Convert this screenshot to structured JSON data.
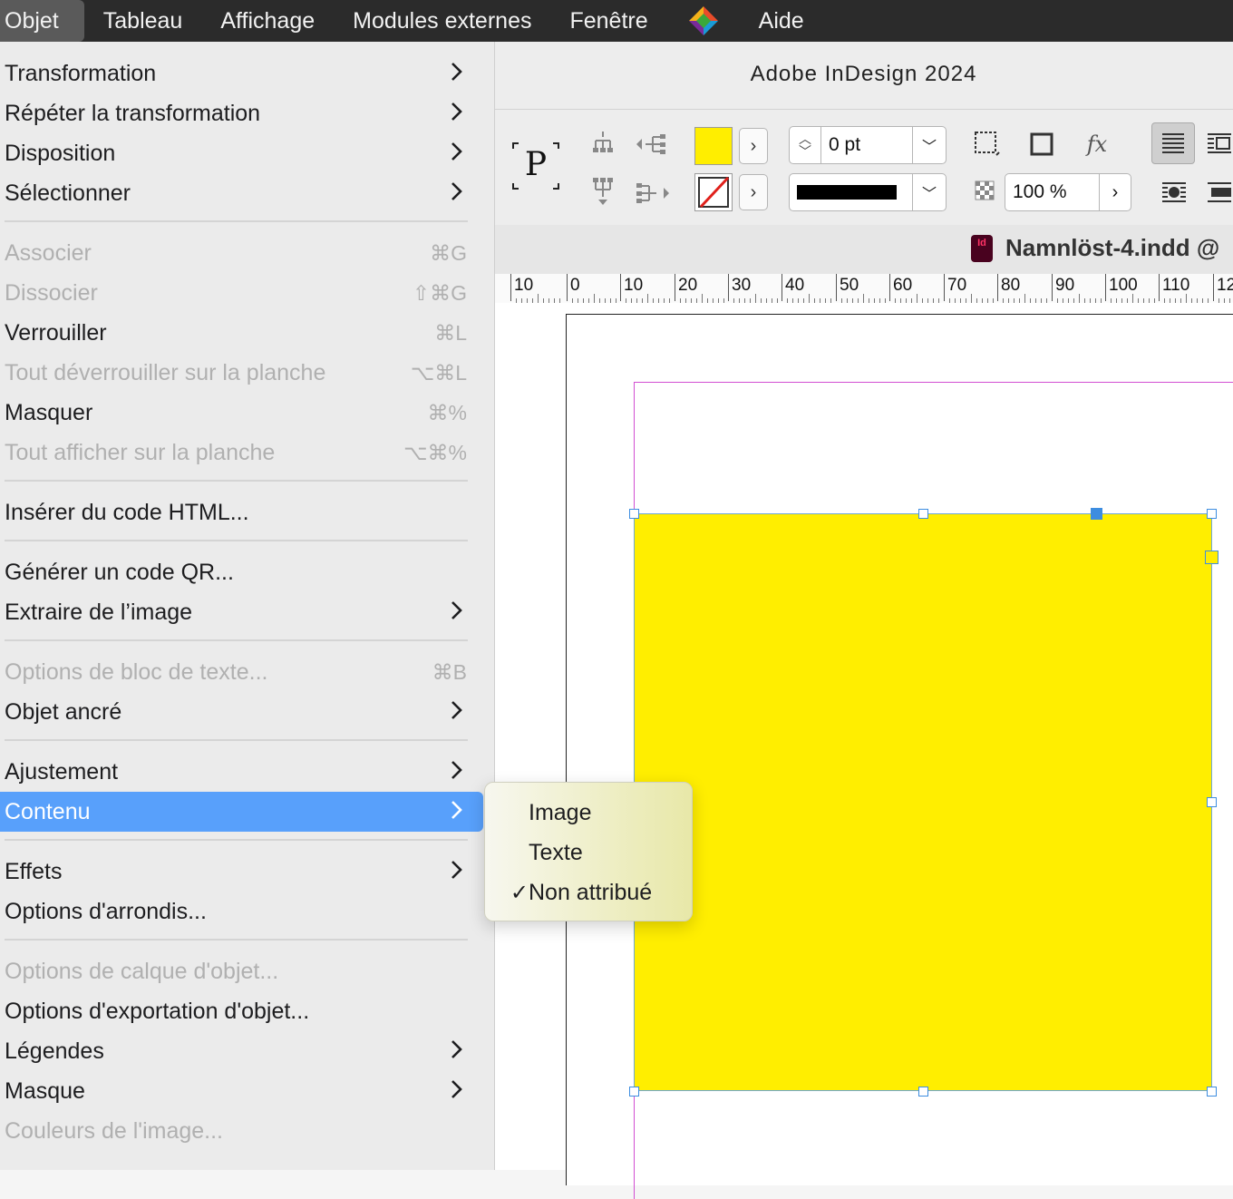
{
  "menubar": {
    "items": [
      "Objet",
      "Tableau",
      "Affichage",
      "Modules externes",
      "Fenêtre"
    ],
    "help": "Aide"
  },
  "app": {
    "title": "Adobe InDesign 2024",
    "doc_tab": "Namnlöst-4.indd @",
    "doc_icon": "Id"
  },
  "controls": {
    "proxy_letter": "P",
    "stroke_weight": "0 pt",
    "opacity": "100 %",
    "fill_color": "#ffee00",
    "fx_label": "fx"
  },
  "ruler": {
    "labels": [
      "10",
      "0",
      "10",
      "20",
      "30",
      "40",
      "50",
      "60",
      "70",
      "80",
      "90",
      "100",
      "110",
      "12"
    ]
  },
  "menu": {
    "group1": [
      {
        "label": "Transformation",
        "submenu": true
      },
      {
        "label": "Répéter la transformation",
        "submenu": true
      },
      {
        "label": "Disposition",
        "submenu": true
      },
      {
        "label": "Sélectionner",
        "submenu": true
      }
    ],
    "group2": [
      {
        "label": "Associer",
        "shortcut": "⌘G",
        "disabled": true
      },
      {
        "label": "Dissocier",
        "shortcut": "⇧⌘G",
        "disabled": true
      },
      {
        "label": "Verrouiller",
        "shortcut": "⌘L"
      },
      {
        "label": "Tout déverrouiller sur la planche",
        "shortcut": "⌥⌘L",
        "disabled": true
      },
      {
        "label": "Masquer",
        "shortcut": "⌘%"
      },
      {
        "label": "Tout afficher sur la planche",
        "shortcut": "⌥⌘%",
        "disabled": true
      }
    ],
    "group3": [
      {
        "label": "Insérer du code HTML..."
      }
    ],
    "group4": [
      {
        "label": "Générer un code QR..."
      },
      {
        "label": "Extraire de l’image",
        "submenu": true
      }
    ],
    "group5": [
      {
        "label": "Options de bloc de texte...",
        "shortcut": "⌘B",
        "disabled": true
      },
      {
        "label": "Objet ancré",
        "submenu": true
      }
    ],
    "group6": [
      {
        "label": "Ajustement",
        "submenu": true
      },
      {
        "label": "Contenu",
        "submenu": true,
        "highlighted": true
      }
    ],
    "group7": [
      {
        "label": "Effets",
        "submenu": true
      },
      {
        "label": "Options d'arrondis..."
      }
    ],
    "group8": [
      {
        "label": "Options de calque d'objet...",
        "disabled": true
      },
      {
        "label": "Options d'exportation d'objet..."
      },
      {
        "label": "Légendes",
        "submenu": true
      },
      {
        "label": "Masque",
        "submenu": true
      },
      {
        "label": "Couleurs de l'image...",
        "disabled": true
      }
    ]
  },
  "submenu": {
    "items": [
      {
        "label": "Image",
        "checked": false
      },
      {
        "label": "Texte",
        "checked": false
      },
      {
        "label": "Non attribué",
        "checked": true
      }
    ],
    "check_glyph": "✓"
  }
}
